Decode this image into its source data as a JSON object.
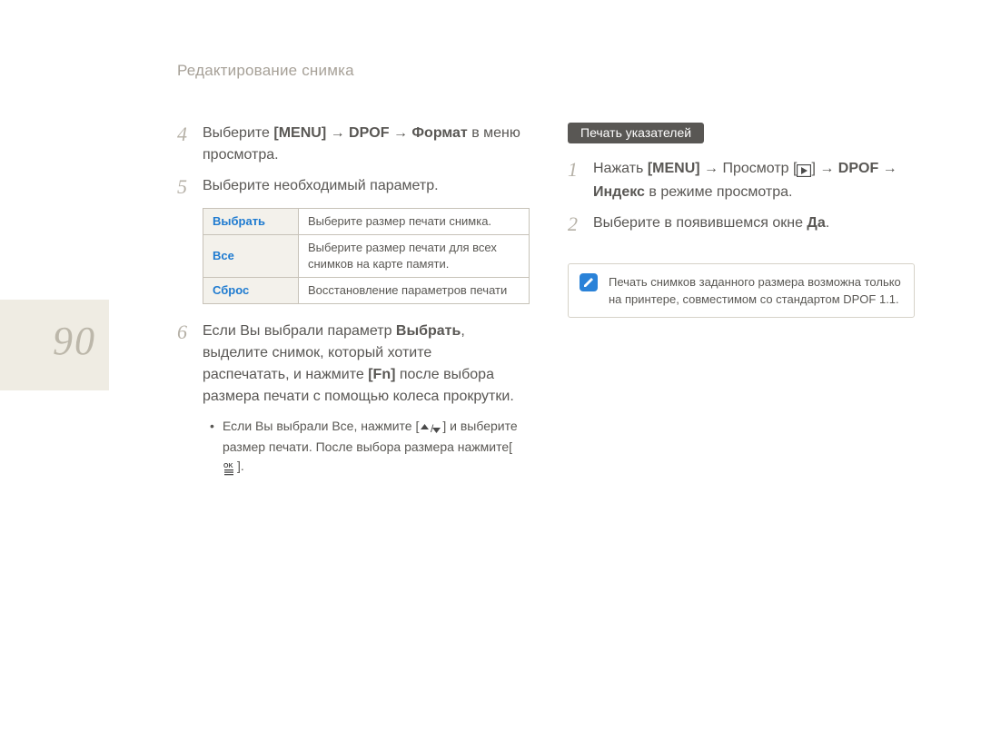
{
  "header": {
    "title": "Редактирование снимка"
  },
  "sideTab": {
    "pageNumber": "90"
  },
  "left": {
    "steps": [
      {
        "num": "4",
        "parts": [
          {
            "t": "Выберите "
          },
          {
            "t": "[MENU]",
            "b": true
          },
          {
            "t": " → "
          },
          {
            "t": "DPOF",
            "b": true
          },
          {
            "t": " → "
          },
          {
            "t": "Формат",
            "b": true
          },
          {
            "t": " в меню просмотра."
          }
        ]
      },
      {
        "num": "5",
        "parts": [
          {
            "t": "Выберите необходимый параметр."
          }
        ]
      }
    ],
    "table": [
      {
        "key": "Выбрать",
        "val": "Выберите размер печати снимка."
      },
      {
        "key": "Все",
        "val": "Выберите размер печати для всех снимков на карте памяти."
      },
      {
        "key": "Сброс",
        "val": "Восстановление параметров печати"
      }
    ],
    "step6": {
      "num": "6",
      "parts": [
        {
          "t": "Если Вы выбрали параметр "
        },
        {
          "t": "Выбрать",
          "b": true
        },
        {
          "t": ", выделите снимок, который хотите распечатать, и нажмите "
        },
        {
          "t": "[Fn]",
          "b": true
        },
        {
          "t": " после выбора размера печати с помощью колеса прокрутки."
        }
      ]
    },
    "bullet": {
      "before": "Если Вы выбрали Все, нажмите [",
      "mid": "] и выберите размер печати. После выбора размера нажмите[",
      "after": "]."
    }
  },
  "right": {
    "pill": "Печать указателей",
    "step1": {
      "num": "1",
      "pre": "Нажать ",
      "menu": "[MENU]",
      "arrow1": " → Просмотр [",
      "arrow2": "] → ",
      "dpof": "DPOF",
      "arrow3": " → ",
      "index": "Индекс",
      "tail": " в режиме просмотра."
    },
    "step2": {
      "num": "2",
      "pre": "Выберите в появившемся окне ",
      "yes": "Да",
      "tail": "."
    },
    "note": "Печать снимков заданного размера возможна только на принтере, совместимом со стандартом DPOF 1.1."
  },
  "icons": {
    "playBox": "play-box-icon",
    "upDown": "up-down-icon",
    "ok": "ok-menu-icon",
    "notePencil": "note-pencil-icon"
  }
}
